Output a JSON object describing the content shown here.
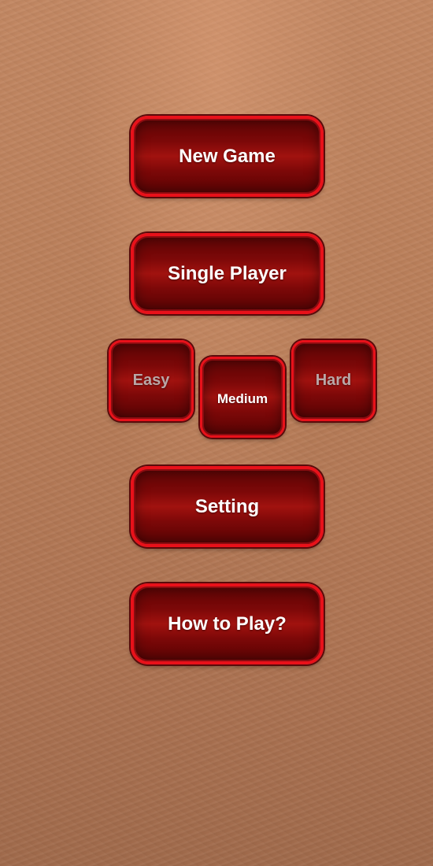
{
  "menu": {
    "new_game": "New Game",
    "single_player": "Single Player",
    "setting": "Setting",
    "how_to_play": "How to Play?"
  },
  "difficulty": {
    "options": [
      "Easy",
      "Medium",
      "Hard"
    ],
    "selected": "Medium"
  },
  "colors": {
    "button_border": "#e8111a",
    "button_fill": "#7c0808",
    "active_text": "#ffffff",
    "inactive_text": "#b9a7a7",
    "background": "#b87d58"
  }
}
